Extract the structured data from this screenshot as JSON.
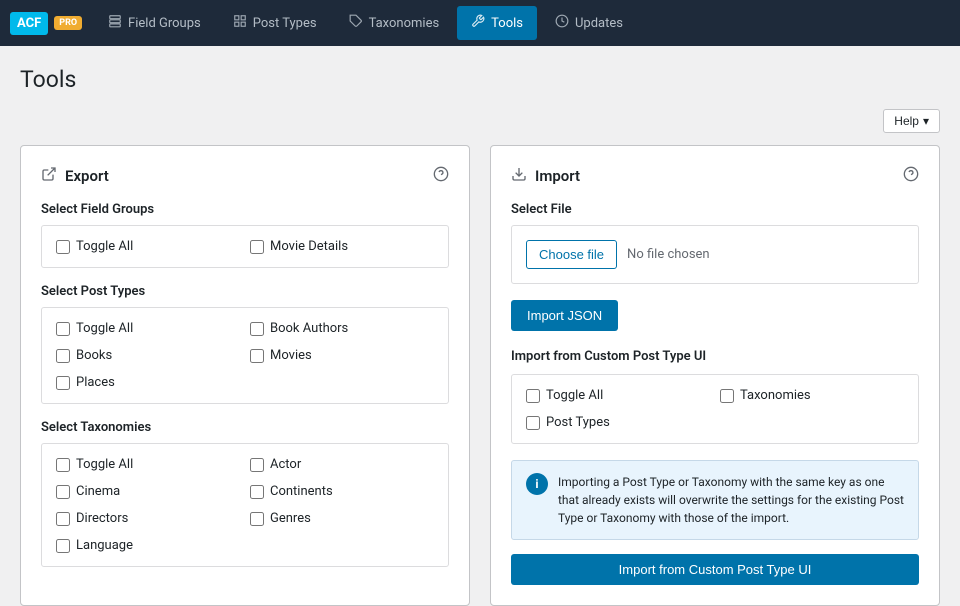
{
  "nav": {
    "logo": "ACF",
    "pro_badge": "PRO",
    "items": [
      {
        "id": "field-groups",
        "label": "Field Groups",
        "icon": "☰",
        "active": false
      },
      {
        "id": "post-types",
        "label": "Post Types",
        "icon": "⊞",
        "active": false
      },
      {
        "id": "taxonomies",
        "label": "Taxonomies",
        "icon": "🏷",
        "active": false
      },
      {
        "id": "tools",
        "label": "Tools",
        "icon": "⚙",
        "active": true
      },
      {
        "id": "updates",
        "label": "Updates",
        "icon": "⏻",
        "active": false
      }
    ]
  },
  "page": {
    "title": "Tools"
  },
  "help_button": "Help",
  "export": {
    "title": "Export",
    "icon": "↗",
    "select_field_groups_label": "Select Field Groups",
    "field_groups": [
      {
        "label": "Toggle All"
      },
      {
        "label": "Movie Details"
      }
    ],
    "select_post_types_label": "Select Post Types",
    "post_types": [
      {
        "label": "Toggle All"
      },
      {
        "label": "Book Authors"
      },
      {
        "label": "Books"
      },
      {
        "label": "Movies"
      },
      {
        "label": "Places"
      }
    ],
    "select_taxonomies_label": "Select Taxonomies",
    "taxonomies": [
      {
        "label": "Toggle All"
      },
      {
        "label": "Actor"
      },
      {
        "label": "Cinema"
      },
      {
        "label": "Continents"
      },
      {
        "label": "Directors"
      },
      {
        "label": "Genres"
      },
      {
        "label": "Language"
      }
    ]
  },
  "import": {
    "title": "Import",
    "icon": "↙",
    "select_file_label": "Select File",
    "choose_file_btn": "Choose file",
    "no_file_text": "No file chosen",
    "import_json_btn": "Import JSON",
    "import_cpt_label": "Import from Custom Post Type UI",
    "cpt_checkboxes": [
      {
        "label": "Toggle All"
      },
      {
        "label": "Taxonomies"
      },
      {
        "label": "Post Types"
      }
    ],
    "info_text": "Importing a Post Type or Taxonomy with the same key as one that already exists will overwrite the settings for the existing Post Type or Taxonomy with those of the import.",
    "import_cpt_btn": "Import from Custom Post Type UI"
  }
}
